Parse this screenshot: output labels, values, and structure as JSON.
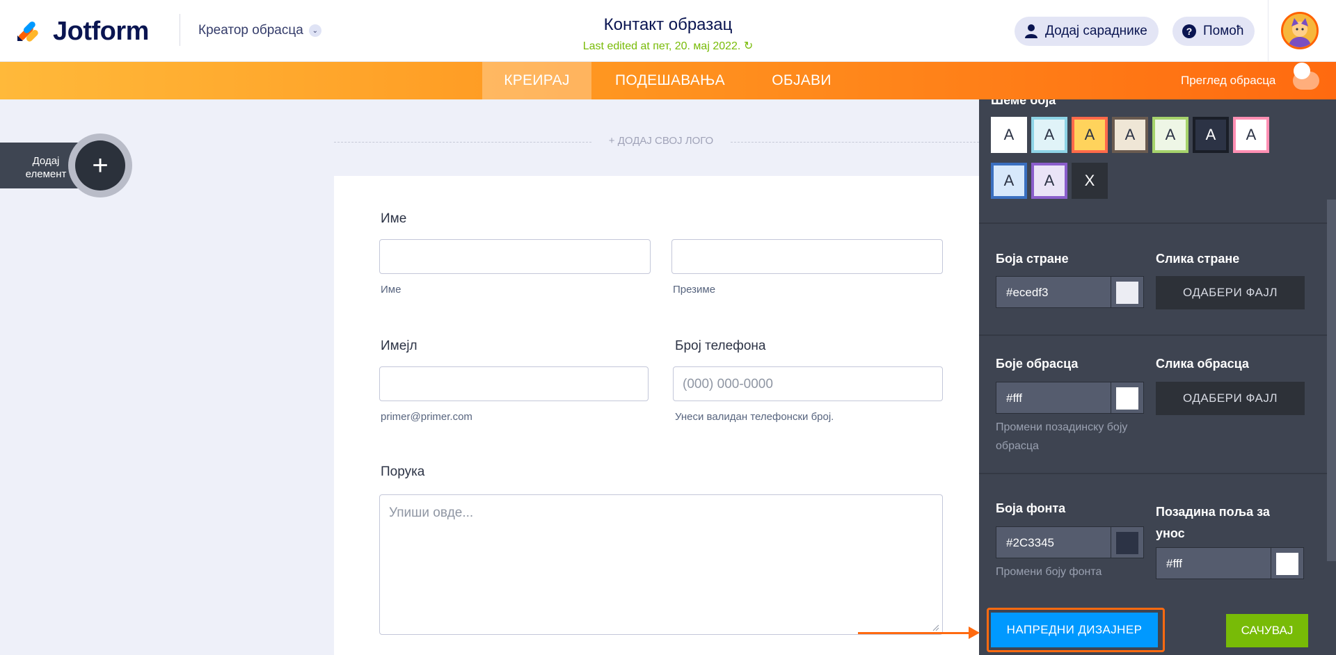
{
  "header": {
    "logo_text": "Jotform",
    "builder_label": "Креатор обрасца",
    "form_title": "Контакт образац",
    "last_edited": "Last edited at пет, 20. мај 2022.",
    "add_collaborators": "Додај сараднике",
    "help": "Помоћ"
  },
  "nav": {
    "tabs": [
      {
        "label": "КРЕИРАЈ",
        "active": true
      },
      {
        "label": "ПОДЕШАВАЊА",
        "active": false
      },
      {
        "label": "ОБЈАВИ",
        "active": false
      }
    ],
    "preview_label": "Преглед обрасца",
    "preview_enabled": false
  },
  "canvas": {
    "add_element_label": "Додај елемент",
    "add_logo": "+ ДОДАЈ СВОЈ ЛОГО"
  },
  "form": {
    "name_label": "Име",
    "first_sublabel": "Име",
    "last_sublabel": "Презиме",
    "email_label": "Имејл",
    "email_sublabel": "primer@primer.com",
    "phone_label": "Број телефона",
    "phone_placeholder": "(000) 000-0000",
    "phone_sublabel": "Унеси валидан телефонски број.",
    "message_label": "Порука",
    "message_placeholder": "Упиши овде..."
  },
  "panel": {
    "schemes_title": "Шеме боја",
    "schemes": [
      {
        "letter": "A",
        "bg": "#ffffff",
        "border": "#ffffff",
        "fg": "#2c3345"
      },
      {
        "letter": "A",
        "bg": "#e0f3f8",
        "border": "#8ed4e6",
        "fg": "#2c3345"
      },
      {
        "letter": "A",
        "bg": "#ffd35c",
        "border": "#ff6a4a",
        "fg": "#2c3345"
      },
      {
        "letter": "A",
        "bg": "#efe6d6",
        "border": "#6a5b50",
        "fg": "#2c3345"
      },
      {
        "letter": "A",
        "bg": "#eef6e6",
        "border": "#a6d36c",
        "fg": "#2c3345"
      },
      {
        "letter": "A",
        "bg": "#2c3345",
        "border": "#1a1e27",
        "fg": "#ffffff"
      },
      {
        "letter": "A",
        "bg": "#ffffff",
        "border": "#ff8fb3",
        "fg": "#2c3345"
      },
      {
        "letter": "A",
        "bg": "#d7e8fb",
        "border": "#3a6fc0",
        "fg": "#2c3345"
      },
      {
        "letter": "A",
        "bg": "#eae4f7",
        "border": "#8a5ecb",
        "fg": "#2c3345"
      },
      {
        "letter": "X",
        "bg": "#2d3138",
        "border": "#2d3138",
        "fg": "#ffffff"
      }
    ],
    "page_color_label": "Боја стране",
    "page_color_value": "#ecedf3",
    "page_image_label": "Слика стране",
    "choose_file": "ОДАБЕРИ ФАЈЛ",
    "form_color_label": "Боје обрасца",
    "form_color_value": "#fff",
    "form_color_hint": "Промени позадинску боју обрасца",
    "form_image_label": "Слика обрасца",
    "font_color_label": "Боја фонта",
    "font_color_value": "#2C3345",
    "font_color_hint": "Промени боју фонта",
    "field_bg_label": "Позадина поља за унос",
    "field_bg_value": "#fff",
    "advanced_designer": "НАПРЕДНИ ДИЗАЈНЕР",
    "save": "САЧУВАЈ"
  },
  "colors": {
    "brand_navy": "#0a1551",
    "orange": "#ff6a10",
    "green": "#78bb07",
    "blue": "#0099ff",
    "panel_bg": "#3e4451",
    "page_bg": "#eef0f9"
  }
}
